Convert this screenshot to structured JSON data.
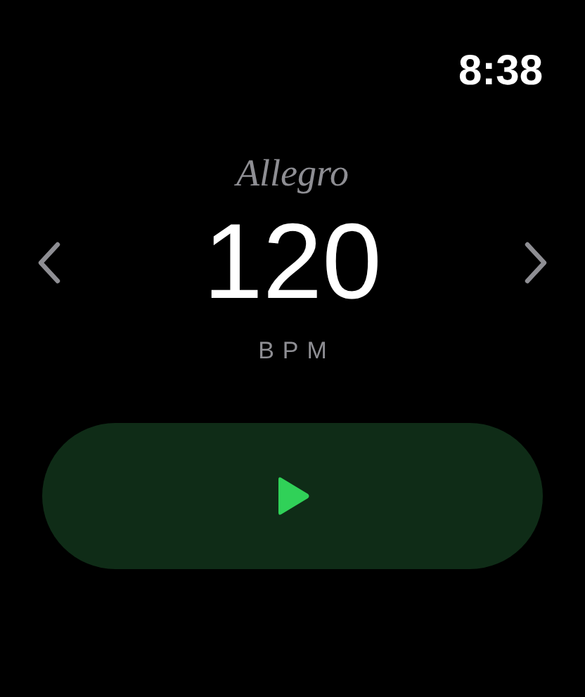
{
  "status_bar": {
    "time": "8:38"
  },
  "tempo": {
    "marking": "Allegro",
    "value": "120",
    "unit": "BPM"
  },
  "play_button": {
    "playing": false
  }
}
